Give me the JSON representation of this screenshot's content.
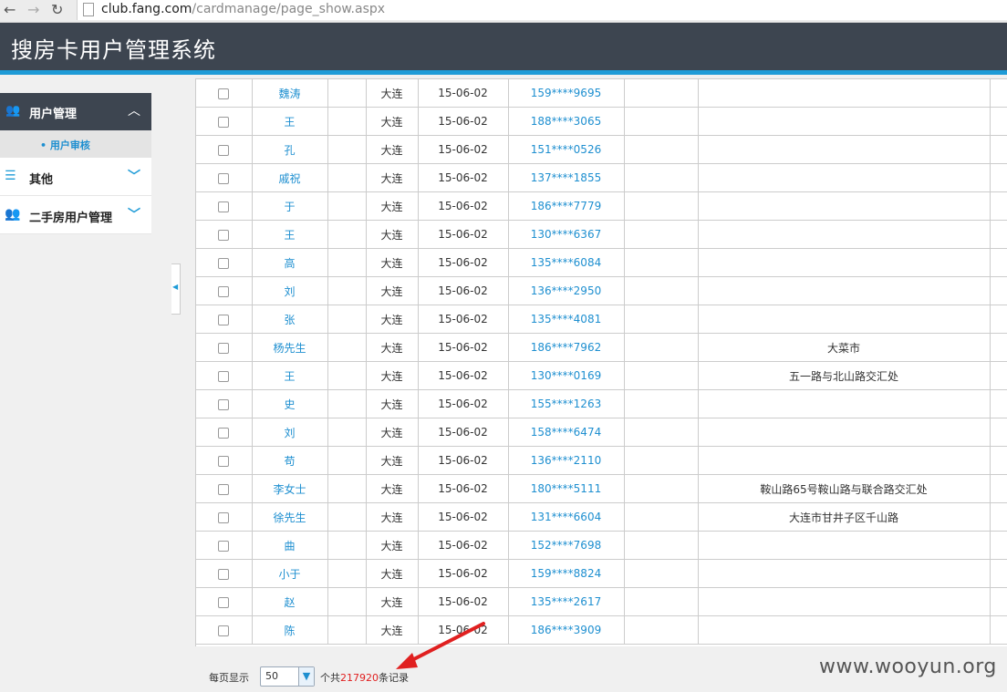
{
  "browser": {
    "back": "←",
    "forward": "→",
    "reload": "↻",
    "url_host": "club.fang.com",
    "url_path": "/cardmanage/page_show.aspx"
  },
  "header": {
    "title": "搜房卡用户管理系统"
  },
  "sidebar": {
    "active_section": "用户管理",
    "active_sub": "用户审核",
    "items": [
      {
        "label": "其他"
      },
      {
        "label": "二手房用户管理"
      }
    ]
  },
  "rows": [
    {
      "name": "魏涛",
      "city": "大连",
      "date": "15-06-02",
      "phone": "159****9695",
      "addr": ""
    },
    {
      "name": "王",
      "city": "大连",
      "date": "15-06-02",
      "phone": "188****3065",
      "addr": ""
    },
    {
      "name": "孔",
      "city": "大连",
      "date": "15-06-02",
      "phone": "151****0526",
      "addr": ""
    },
    {
      "name": "戚祝",
      "city": "大连",
      "date": "15-06-02",
      "phone": "137****1855",
      "addr": ""
    },
    {
      "name": "于",
      "city": "大连",
      "date": "15-06-02",
      "phone": "186****7779",
      "addr": ""
    },
    {
      "name": "王",
      "city": "大连",
      "date": "15-06-02",
      "phone": "130****6367",
      "addr": ""
    },
    {
      "name": "高",
      "city": "大连",
      "date": "15-06-02",
      "phone": "135****6084",
      "addr": ""
    },
    {
      "name": "刘",
      "city": "大连",
      "date": "15-06-02",
      "phone": "136****2950",
      "addr": ""
    },
    {
      "name": "张",
      "city": "大连",
      "date": "15-06-02",
      "phone": "135****4081",
      "addr": ""
    },
    {
      "name": "杨先生",
      "city": "大连",
      "date": "15-06-02",
      "phone": "186****7962",
      "addr": "大菜市"
    },
    {
      "name": "王",
      "city": "大连",
      "date": "15-06-02",
      "phone": "130****0169",
      "addr": "五一路与北山路交汇处"
    },
    {
      "name": "史",
      "city": "大连",
      "date": "15-06-02",
      "phone": "155****1263",
      "addr": ""
    },
    {
      "name": "刘",
      "city": "大连",
      "date": "15-06-02",
      "phone": "158****6474",
      "addr": ""
    },
    {
      "name": "苟",
      "city": "大连",
      "date": "15-06-02",
      "phone": "136****2110",
      "addr": ""
    },
    {
      "name": "李女士",
      "city": "大连",
      "date": "15-06-02",
      "phone": "180****5111",
      "addr": "鞍山路65号鞍山路与联合路交汇处"
    },
    {
      "name": "徐先生",
      "city": "大连",
      "date": "15-06-02",
      "phone": "131****6604",
      "addr": "大连市甘井子区千山路"
    },
    {
      "name": "曲",
      "city": "大连",
      "date": "15-06-02",
      "phone": "152****7698",
      "addr": ""
    },
    {
      "name": "小于",
      "city": "大连",
      "date": "15-06-02",
      "phone": "159****8824",
      "addr": ""
    },
    {
      "name": "赵",
      "city": "大连",
      "date": "15-06-02",
      "phone": "135****2617",
      "addr": ""
    },
    {
      "name": "陈",
      "city": "大连",
      "date": "15-06-02",
      "phone": "186****3909",
      "addr": ""
    }
  ],
  "footer": {
    "per_page_label": "每页显示",
    "per_page_value": "50",
    "total_prefix": "个共",
    "total_count": "217920",
    "total_suffix": "条记录"
  },
  "watermark": "www.wooyun.org",
  "colors": {
    "header_bg": "#3d4550",
    "accent": "#1e9bd7",
    "link": "#1e8fd0",
    "annotation_arrow": "#e02020"
  }
}
